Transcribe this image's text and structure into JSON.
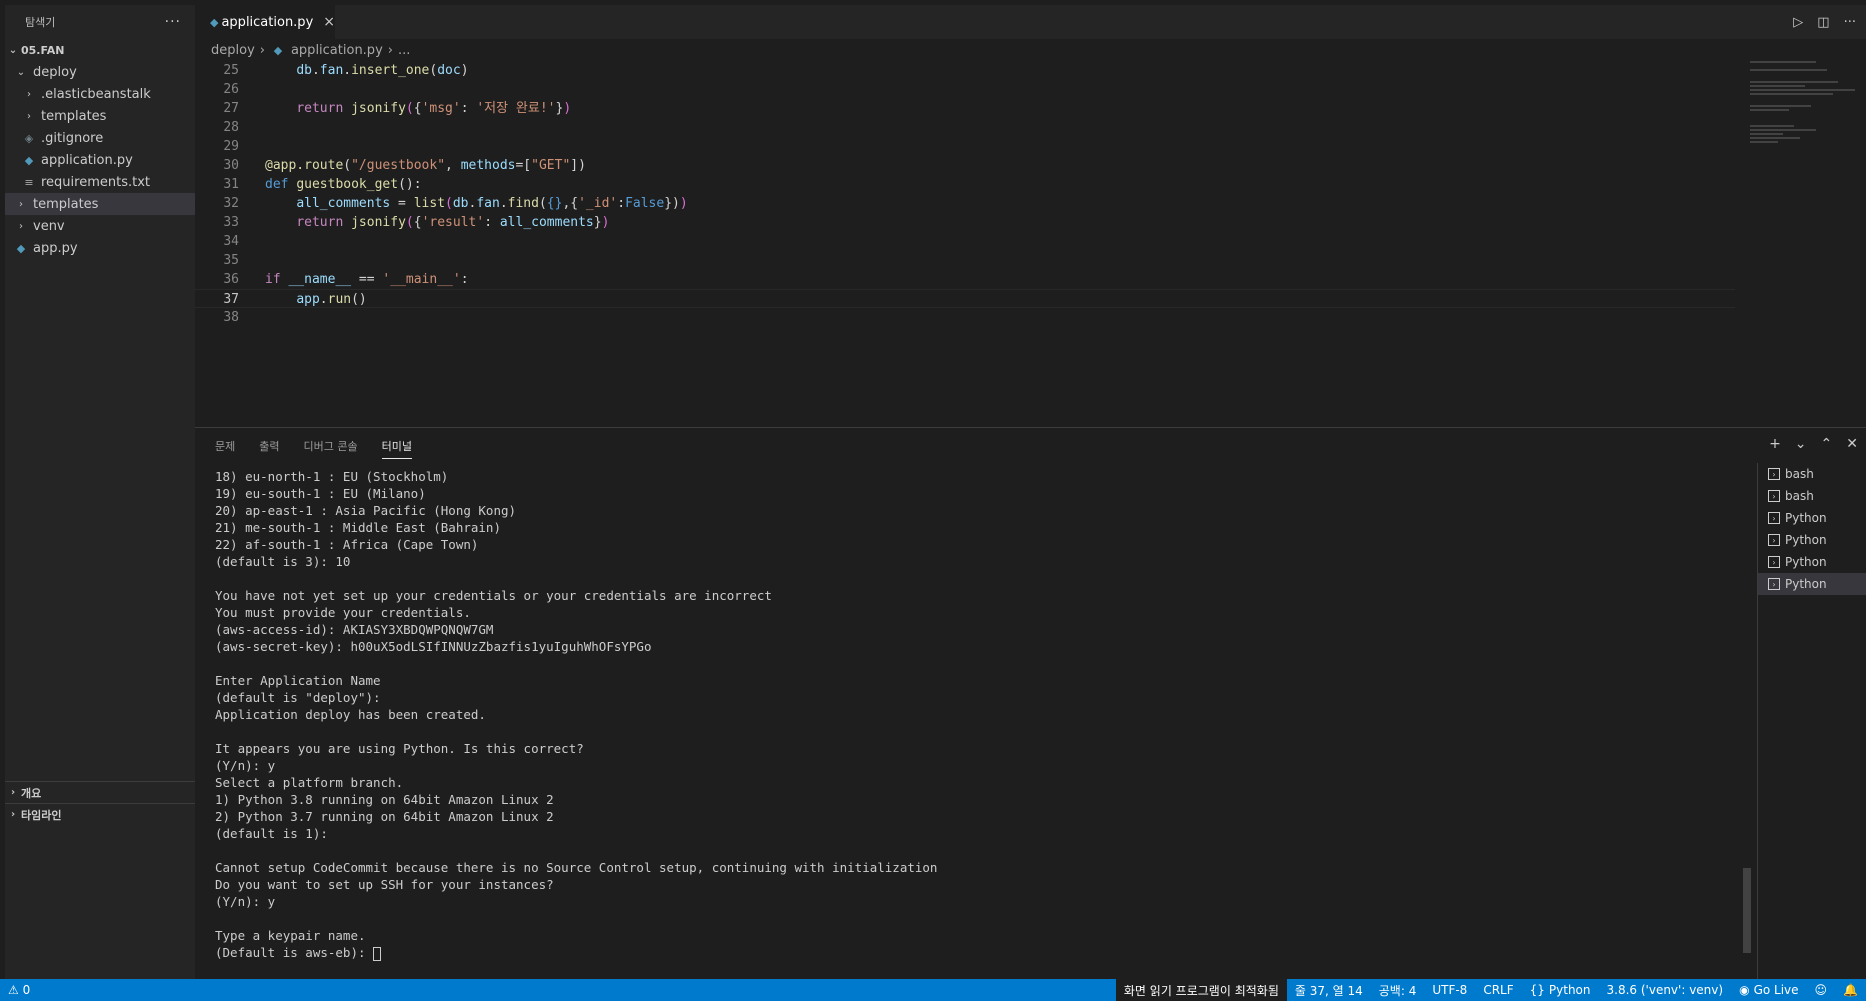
{
  "sidebar": {
    "title": "탐색기",
    "more": "···",
    "root": "05.FAN",
    "items": [
      {
        "label": "deploy",
        "type": "folder-open",
        "indent": 1
      },
      {
        "label": ".elasticbeanstalk",
        "type": "folder",
        "indent": 2
      },
      {
        "label": "templates",
        "type": "folder",
        "indent": 2
      },
      {
        "label": ".gitignore",
        "type": "git",
        "indent": 2
      },
      {
        "label": "application.py",
        "type": "py",
        "indent": 2
      },
      {
        "label": "requirements.txt",
        "type": "txt",
        "indent": 2
      },
      {
        "label": "templates",
        "type": "folder",
        "indent": 1
      },
      {
        "label": "venv",
        "type": "folder",
        "indent": 1
      },
      {
        "label": "app.py",
        "type": "py",
        "indent": 1
      }
    ],
    "outline": "개요",
    "timeline": "타임라인"
  },
  "editor": {
    "tab_label": "application.py",
    "tab_close": "×",
    "breadcrumb": [
      "deploy",
      "application.py",
      "..."
    ],
    "run_icon": "▷",
    "split_icon": "◫",
    "more_icon": "···"
  },
  "code": [
    {
      "n": "25",
      "html": "    <span class='v'>db</span>.<span class='v'>fan</span>.<span class='f'>insert_one</span>(<span class='v'>doc</span>)"
    },
    {
      "n": "26",
      "html": ""
    },
    {
      "n": "27",
      "html": "    <span class='ctl'>return</span> <span class='f'>jsonify</span><span class='p'>(</span>{<span class='s'>'msg'</span>: <span class='s'>'저장 완료!'</span>}<span class='p'>)</span>"
    },
    {
      "n": "28",
      "html": ""
    },
    {
      "n": "29",
      "html": ""
    },
    {
      "n": "30",
      "html": "<span class='f'>@app.route</span>(<span class='s'>\"/guestbook\"</span>, <span class='v'>methods</span>=[<span class='s'>\"GET\"</span>])"
    },
    {
      "n": "31",
      "html": "<span class='k'>def</span> <span class='f'>guestbook_get</span>():"
    },
    {
      "n": "32",
      "html": "    <span class='v'>all_comments</span> = <span class='f'>list</span><span class='p'>(</span><span class='v'>db</span>.<span class='v'>fan</span>.<span class='f'>find</span>(<span class='k'>{}</span>,{<span class='s'>'_id'</span>:<span class='k'>False</span>})<span class='p'>)</span>"
    },
    {
      "n": "33",
      "html": "    <span class='ctl'>return</span> <span class='f'>jsonify</span><span class='p'>(</span>{<span class='s'>'result'</span>: <span class='v'>all_comments</span>}<span class='p'>)</span>"
    },
    {
      "n": "34",
      "html": ""
    },
    {
      "n": "35",
      "html": ""
    },
    {
      "n": "36",
      "html": "<span class='ctl'>if</span> <span class='v'>__name__</span> == <span class='s'>'__main__'</span>:"
    },
    {
      "n": "37",
      "html": "    <span class='v'>app</span>.<span class='f'>run</span>()",
      "active": true
    },
    {
      "n": "38",
      "html": ""
    }
  ],
  "panel": {
    "tabs": [
      "문제",
      "출력",
      "디버그 콘솔",
      "터미널"
    ],
    "active_tab": 3,
    "terminal_lines": [
      "18) eu-north-1 : EU (Stockholm)",
      "19) eu-south-1 : EU (Milano)",
      "20) ap-east-1 : Asia Pacific (Hong Kong)",
      "21) me-south-1 : Middle East (Bahrain)",
      "22) af-south-1 : Africa (Cape Town)",
      "(default is 3): 10",
      "",
      "You have not yet set up your credentials or your credentials are incorrect",
      "You must provide your credentials.",
      "(aws-access-id): AKIASY3XBDQWPQNQW7GM",
      "(aws-secret-key): h00uX5odLSIfINNUzZbazfis1yuIguhWhOFsYPGo",
      "",
      "Enter Application Name",
      "(default is \"deploy\"):",
      "Application deploy has been created.",
      "",
      "It appears you are using Python. Is this correct?",
      "(Y/n): y",
      "Select a platform branch.",
      "1) Python 3.8 running on 64bit Amazon Linux 2",
      "2) Python 3.7 running on 64bit Amazon Linux 2",
      "(default is 1):",
      "",
      "Cannot setup CodeCommit because there is no Source Control setup, continuing with initialization",
      "Do you want to set up SSH for your instances?",
      "(Y/n): y",
      "",
      "Type a keypair name.",
      "(Default is aws-eb): "
    ],
    "terminals": [
      "bash",
      "bash",
      "Python",
      "Python",
      "Python",
      "Python"
    ],
    "selected_terminal": 5
  },
  "status": {
    "errors": "⚠ 0",
    "screen_reader": "화면 읽기 프로그램이 최적화됨",
    "position": "줄 37, 열 14",
    "spaces": "공백: 4",
    "encoding": "UTF-8",
    "eol": "CRLF",
    "language": "Python",
    "interpreter": "3.8.6 ('venv': venv)",
    "golive": "Go Live"
  }
}
